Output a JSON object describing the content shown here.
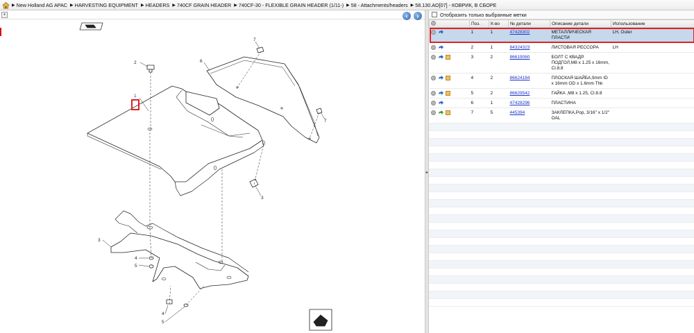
{
  "breadcrumb": [
    "New Holland AG APAC",
    "HARVESTING EQUIPMENT",
    "HEADERS",
    "740CF GRAIN HEADER",
    "740CF-30 - FLEXIBLE GRAIN HEADER (1/11-)",
    "58 - Attachments/headers",
    "58.130.AO[07] - КОВРИК, В СБОРЕ"
  ],
  "filter": {
    "label": "Отобразить только выбранные метки",
    "checked": false
  },
  "table": {
    "headers": [
      "",
      "Поз.",
      "К-во",
      "№ детали",
      "Описание детали",
      "Использование"
    ],
    "rows": [
      {
        "pos": "1",
        "qty": "1",
        "part": "47428302",
        "desc": "МЕТАЛЛИЧЕСКАЯ ПЛАСТИ",
        "use": "LH, Outer",
        "box": false,
        "selected": true,
        "arrow": "blue"
      },
      {
        "pos": "2",
        "qty": "1",
        "part": "84324323",
        "desc": "ЛИСТОВАЯ РЕССОРА",
        "use": "LH",
        "box": false,
        "selected": false,
        "arrow": "blue"
      },
      {
        "pos": "3",
        "qty": "2",
        "part": "86619060",
        "desc": "БОЛТ С КВАДР. ПОДГОЛ,M8 x 1.25 x 16mm, Cl.8.8",
        "use": "",
        "box": true,
        "selected": false,
        "arrow": "blue"
      },
      {
        "pos": "4",
        "qty": "2",
        "part": "86624184",
        "desc": "ПЛОСКАЯ ШАЙБА,9mm ID x 16mm OD x 1.6mm Thk",
        "use": "",
        "box": true,
        "selected": false,
        "arrow": "blue"
      },
      {
        "pos": "5",
        "qty": "2",
        "part": "86629542",
        "desc": "ГАЙКА ,M8 x 1.25, Cl.8.8",
        "use": "",
        "box": true,
        "selected": false,
        "arrow": "blue"
      },
      {
        "pos": "6",
        "qty": "1",
        "part": "47428296",
        "desc": "ПЛАСТИНА",
        "use": "",
        "box": false,
        "selected": false,
        "arrow": "blue"
      },
      {
        "pos": "7",
        "qty": "5",
        "part": "445394",
        "desc": "ЗАКЛЕПКА,Pop, 3/16\" x 1/2\" OAL",
        "use": "",
        "box": true,
        "selected": false,
        "arrow": "green"
      }
    ]
  },
  "diagram": {
    "callouts": [
      "1",
      "2",
      "3",
      "3",
      "4",
      "4",
      "5",
      "5",
      "6",
      "7",
      "7"
    ]
  },
  "colors": {
    "selection": "#c5d8ec",
    "highlight": "#d22222",
    "link": "#1a33cc"
  },
  "icons": {
    "home": "home-icon",
    "back": "back-icon",
    "forward": "forward-icon"
  }
}
